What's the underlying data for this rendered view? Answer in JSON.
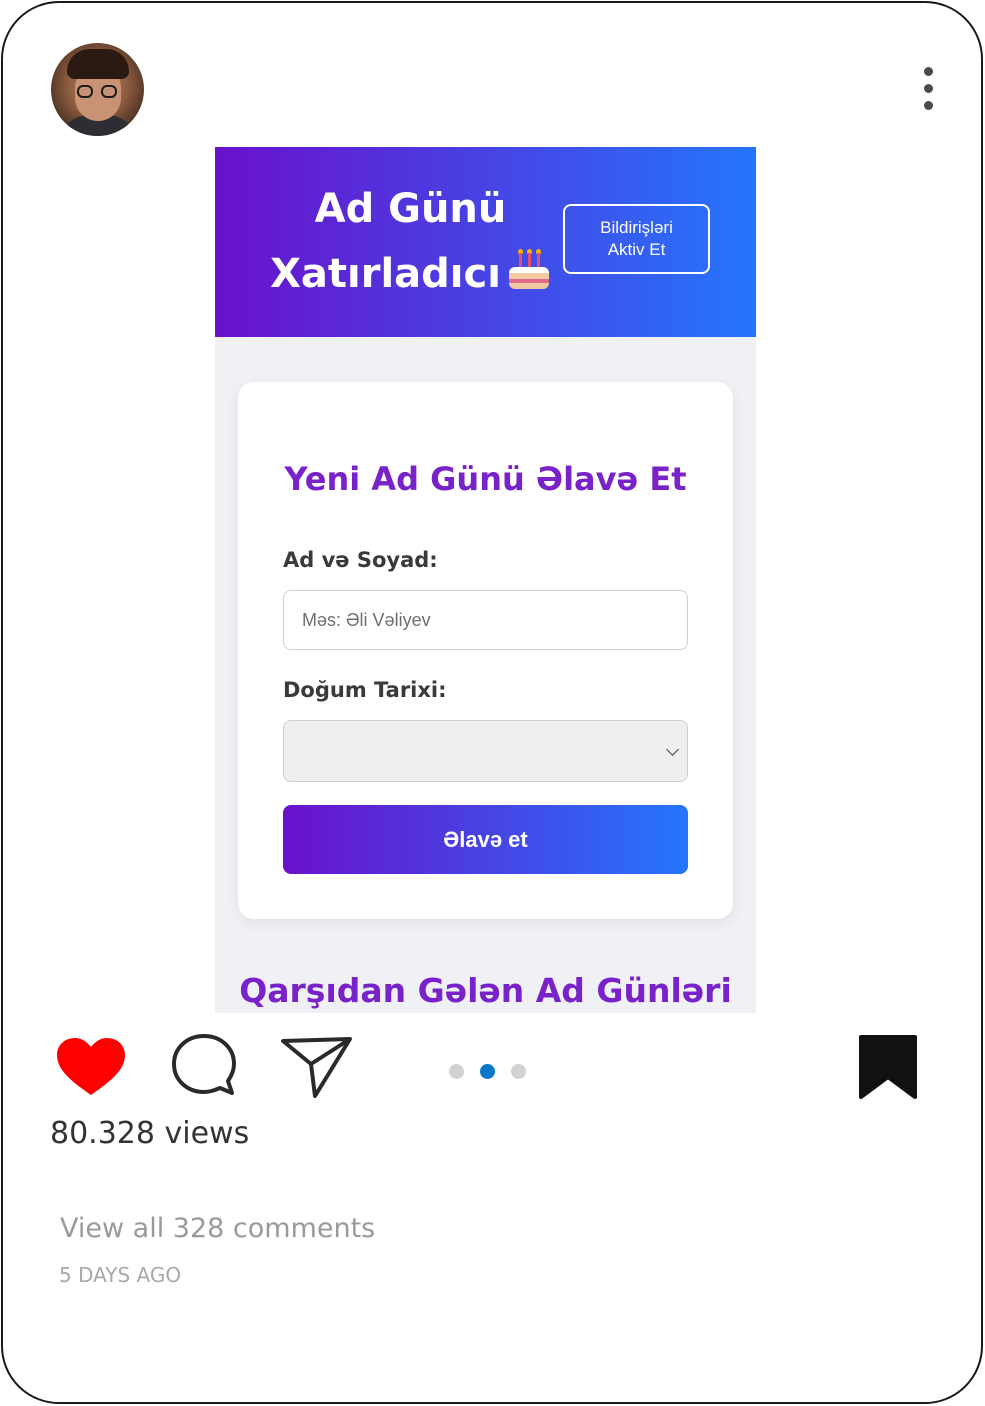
{
  "post": {
    "views": "80.328 views",
    "comments_link": "View all 328 comments",
    "timestamp": "5 DAYS AGO",
    "like_color": "#ff0000",
    "active_slide": 2,
    "slide_count": 3
  },
  "app": {
    "title_line1": "Ad Günü",
    "title_line2": "Xatırladıcı",
    "notif_button": "Bildirişləri Aktiv Et",
    "gradient_start": "#6a11cb",
    "gradient_end": "#2575fc",
    "form": {
      "title": "Yeni Ad Günü Əlavə Et",
      "name_label": "Ad və Soyad:",
      "name_placeholder": "Məs: Əli Vəliyev",
      "date_label": "Doğum Tarixi:",
      "submit_label": "Əlavə et"
    },
    "upcoming_title": "Qarşıdan Gələn Ad Günləri"
  }
}
